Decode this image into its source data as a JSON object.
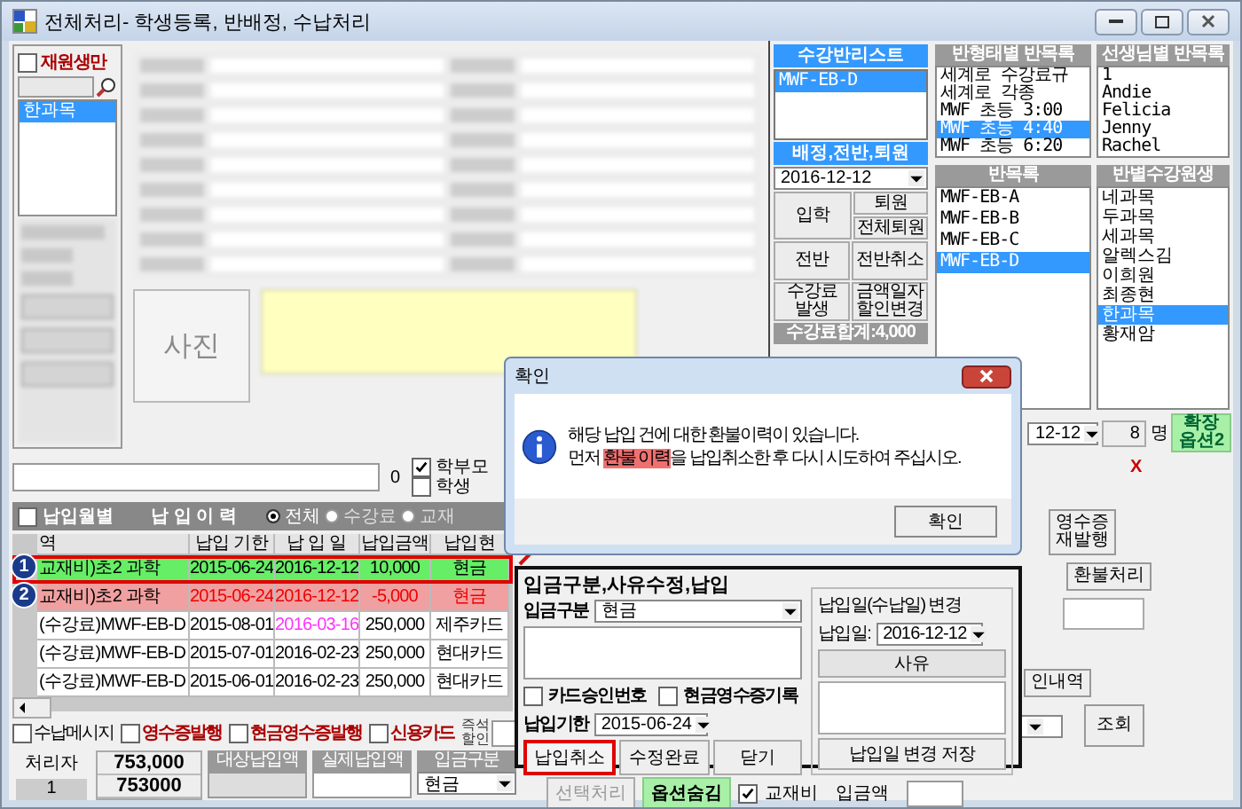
{
  "window": {
    "title": "전체처리- 학생등록, 반배정, 수납처리"
  },
  "sidebar": {
    "filter": {
      "label": "재원생만",
      "checked": false
    },
    "students": [
      {
        "name": "한과목",
        "selected": true
      }
    ]
  },
  "photo": {
    "placeholder": "사진"
  },
  "class_list": {
    "title": "수강반리스트",
    "items": [
      {
        "label": "MWF-EB-D",
        "selected": true
      }
    ]
  },
  "assignment": {
    "title": "배정,전반,퇴원",
    "date": "2016-12-12",
    "enroll_button": "입학",
    "leave_buttons": [
      "퇴원",
      "전체퇴원"
    ],
    "buttons": [
      "전반",
      "전반취소",
      "수강료\n발생",
      "금액일자\n할인변경"
    ],
    "total": "수강료합계:4,000"
  },
  "class_types": {
    "title": "반형태별 반목록",
    "items": [
      {
        "label": "세계로 수강료규",
        "selected": false
      },
      {
        "label": "세계로 각종",
        "selected": false
      },
      {
        "label": "MWF 초등 3:00",
        "selected": false
      },
      {
        "label": "MWF 초등 4:40",
        "selected": true
      },
      {
        "label": "MWF 초등 6:20",
        "selected": false
      }
    ]
  },
  "teachers": {
    "title": "선생님별 반목록",
    "items": [
      {
        "label": "1",
        "selected": false
      },
      {
        "label": "Andie",
        "selected": false
      },
      {
        "label": "Felicia",
        "selected": false
      },
      {
        "label": "Jenny",
        "selected": false
      },
      {
        "label": "Rachel",
        "selected": false
      }
    ]
  },
  "classes": {
    "title": "반목록",
    "items": [
      {
        "label": "MWF-EB-A",
        "selected": false
      },
      {
        "label": "MWF-EB-B",
        "selected": false
      },
      {
        "label": "MWF-EB-C",
        "selected": false
      },
      {
        "label": "MWF-EB-D",
        "selected": true
      }
    ]
  },
  "class_students": {
    "title": "반별수강원생",
    "items": [
      {
        "label": "네과목",
        "selected": false
      },
      {
        "label": "두과목",
        "selected": false
      },
      {
        "label": "세과목",
        "selected": false
      },
      {
        "label": "알렉스김",
        "selected": false
      },
      {
        "label": "이희원",
        "selected": false
      },
      {
        "label": "최종현",
        "selected": false
      },
      {
        "label": "한과목",
        "selected": true
      },
      {
        "label": "황재암",
        "selected": false
      }
    ]
  },
  "enroll_bar": {
    "date": "12-12",
    "count": "8",
    "unit": "명",
    "option_button": "확장\n옵션2"
  },
  "notify": {
    "value": "0",
    "recipients": [
      {
        "label": "학부모",
        "checked": true
      },
      {
        "label": "학생",
        "checked": false
      }
    ]
  },
  "history": {
    "monthly": {
      "label": "납입월별",
      "checked": false
    },
    "title": "납 입 이 력",
    "filters": [
      {
        "label": "전체",
        "selected": true
      },
      {
        "label": "수강료",
        "selected": false
      },
      {
        "label": "교재",
        "selected": false
      }
    ],
    "columns": [
      "역",
      "납입 기한",
      "납 입 일",
      "납입금액",
      "납입현"
    ],
    "rows": [
      {
        "kind": "paid",
        "framed": true,
        "marker": "1",
        "cells": [
          "교재비)초2 과학",
          "2015-06-24",
          "2016-12-12",
          "10,000",
          "현금"
        ]
      },
      {
        "kind": "refund",
        "framed": false,
        "marker": "2",
        "cells": [
          "교재비)초2 과학",
          "2015-06-24",
          "2016-12-12",
          "-5,000",
          "현금"
        ]
      },
      {
        "kind": "changed",
        "framed": false,
        "cells": [
          "(수강료)MWF-EB-D",
          "2015-08-01",
          "2016-03-16",
          "250,000",
          "제주카드"
        ]
      },
      {
        "kind": "normal",
        "framed": false,
        "cells": [
          "(수강료)MWF-EB-D",
          "2015-07-01",
          "2016-02-23",
          "250,000",
          "현대카드"
        ]
      },
      {
        "kind": "normal",
        "framed": false,
        "cells": [
          "(수강료)MWF-EB-D",
          "2015-06-01",
          "2016-02-23",
          "250,000",
          "현대카드"
        ]
      }
    ]
  },
  "options": [
    {
      "label": "수납메시지",
      "checked": false,
      "emphasis": false
    },
    {
      "label": "영수증발행",
      "checked": false,
      "emphasis": true
    },
    {
      "label": "현금영수증발행",
      "checked": false,
      "emphasis": true
    },
    {
      "label": "신용카드",
      "checked": false,
      "emphasis": true
    }
  ],
  "instant_discount": "즉석\n할인",
  "totals": {
    "operator_label": "처리자",
    "operator": "1",
    "amount": "753,000",
    "amount_raw": "753000",
    "target_label": "대상납입액",
    "actual_label": "실제납입액",
    "method_label": "입금구분",
    "method": "현금"
  },
  "bottom_actions": {
    "select_button": {
      "label": "선택처리",
      "disabled": true
    },
    "hide_button": "옵션숨김",
    "material": {
      "label": "교재비",
      "checked": true
    },
    "amount_label": "입금액"
  },
  "side_actions": {
    "close": "X",
    "reissue": "영수증\n재발행",
    "refund": "환불처리",
    "history": "인내역",
    "search": "조회"
  },
  "edit_panel": {
    "title": "입금구분,사유수정,납입",
    "method_label": "입금구분",
    "method": "현금",
    "options": [
      {
        "label": "카드승인번호",
        "checked": false
      },
      {
        "label": "현금영수증기록",
        "checked": false
      }
    ],
    "due_label": "납입기한",
    "due": "2015-06-24",
    "buttons": [
      {
        "label": "납입취소",
        "highlighted": true
      },
      {
        "label": "수정완료",
        "highlighted": false
      },
      {
        "label": "닫기",
        "highlighted": false
      }
    ],
    "date_change": {
      "title": "납입일(수납일) 변경",
      "date_label": "납입일:",
      "date": "2016-12-12",
      "reason_header": "사유",
      "save": "납입일 변경 저장"
    }
  },
  "dialog": {
    "title": "확인",
    "line1": "해당 납입 건에 대한 환불이력이 있습니다.",
    "line2": [
      {
        "text": "먼저 ",
        "highlight": false
      },
      {
        "text": "환불 이력",
        "highlight": true
      },
      {
        "text": "을 납입취소한 후 다시 시도하여 주십시오.",
        "highlight": false
      }
    ],
    "button": "확인"
  }
}
